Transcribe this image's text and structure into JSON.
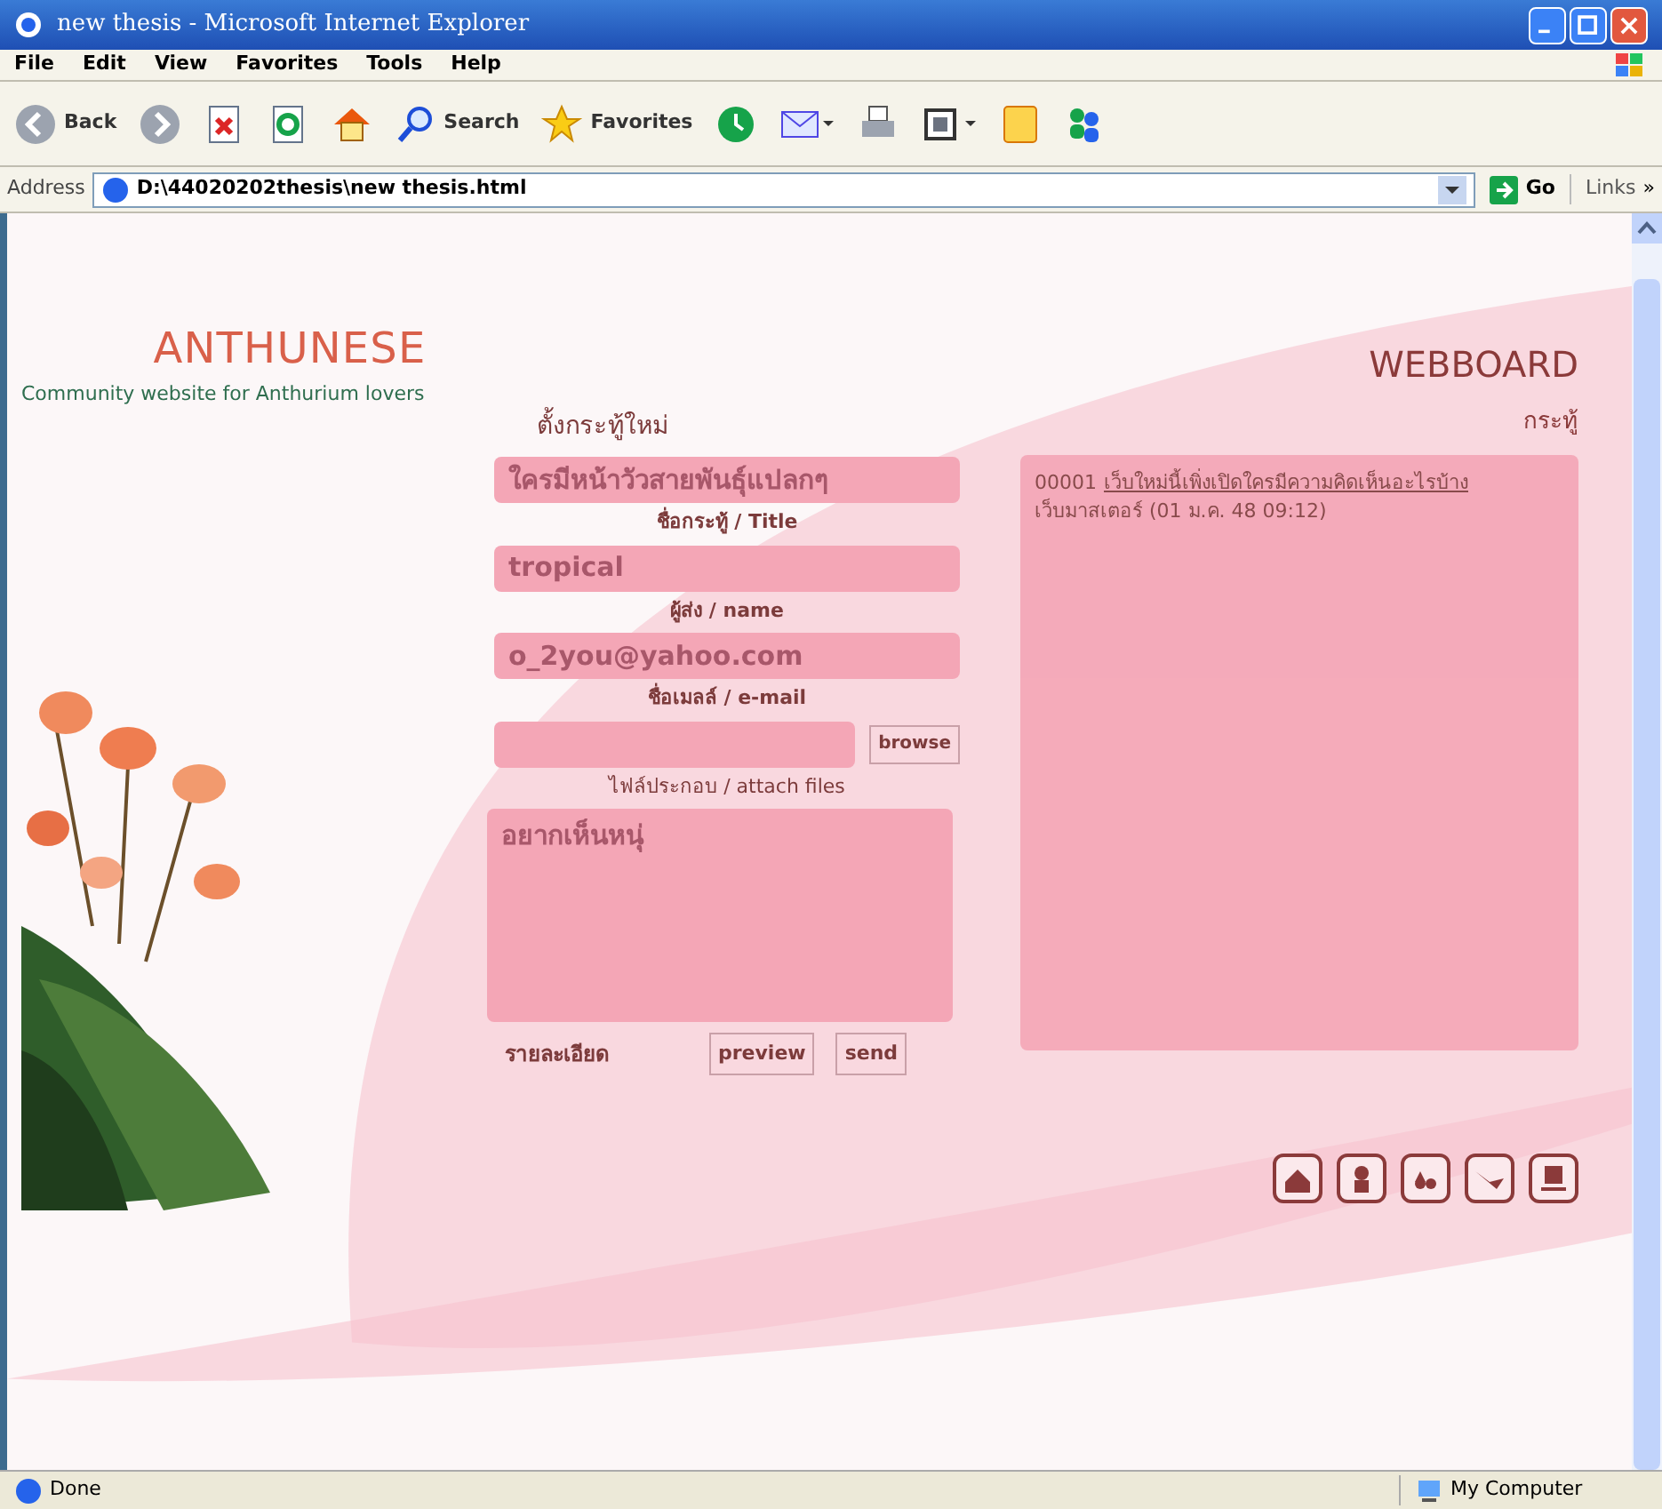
{
  "window": {
    "title": "new thesis - Microsoft Internet Explorer"
  },
  "menu": [
    "File",
    "Edit",
    "View",
    "Favorites",
    "Tools",
    "Help"
  ],
  "toolbar": [
    {
      "kind": "back",
      "label": "Back"
    },
    {
      "kind": "forward"
    },
    {
      "kind": "stop"
    },
    {
      "kind": "refresh"
    },
    {
      "kind": "home"
    },
    {
      "kind": "search",
      "label": "Search"
    },
    {
      "kind": "favorites",
      "label": "Favorites"
    },
    {
      "kind": "history"
    },
    {
      "kind": "mail"
    },
    {
      "kind": "print"
    },
    {
      "kind": "edit"
    },
    {
      "kind": "note"
    },
    {
      "kind": "messenger"
    }
  ],
  "address": {
    "label": "Address",
    "value": "D:\\44020202thesis\\new thesis.html",
    "go": "Go",
    "links": "Links",
    "more": "»"
  },
  "page": {
    "logo": "ANTHUNESE",
    "tagline": "Community website for Anthurium lovers",
    "form": {
      "heading": "ตั้งกระทู้ใหม่",
      "fields": [
        {
          "kind": "text",
          "value": "ใครมีหน้าวัวสายพันธุ์แปลกๆ",
          "caption": "ชื่อกระทู้ / Title"
        },
        {
          "kind": "text",
          "value": "tropical",
          "caption": "ผู้ส่ง / name"
        },
        {
          "kind": "text",
          "value": "o_2you@yahoo.com",
          "caption": "ชื่อเมลล์ / e-mail"
        },
        {
          "kind": "file",
          "button": "browse",
          "caption": "ไฟล์ประกอบ / attach files"
        },
        {
          "kind": "area",
          "value": "อยากเห็นหนุ่",
          "caption": "รายละเอียด"
        }
      ],
      "buttons": [
        "preview",
        "send"
      ]
    },
    "webboard": {
      "title": "WEBBOARD",
      "subtitle": "กระทู้",
      "posts": [
        {
          "number": "00001",
          "link": "เว็บใหม่นี้เพิ่งเปิดใครมีความคิดเห็นอะไรบ้าง",
          "meta": "เว็บมาสเตอร์ (01 ม.ค. 48 09:12)"
        }
      ]
    }
  },
  "status": {
    "text": "Done",
    "zone": "My Computer"
  }
}
